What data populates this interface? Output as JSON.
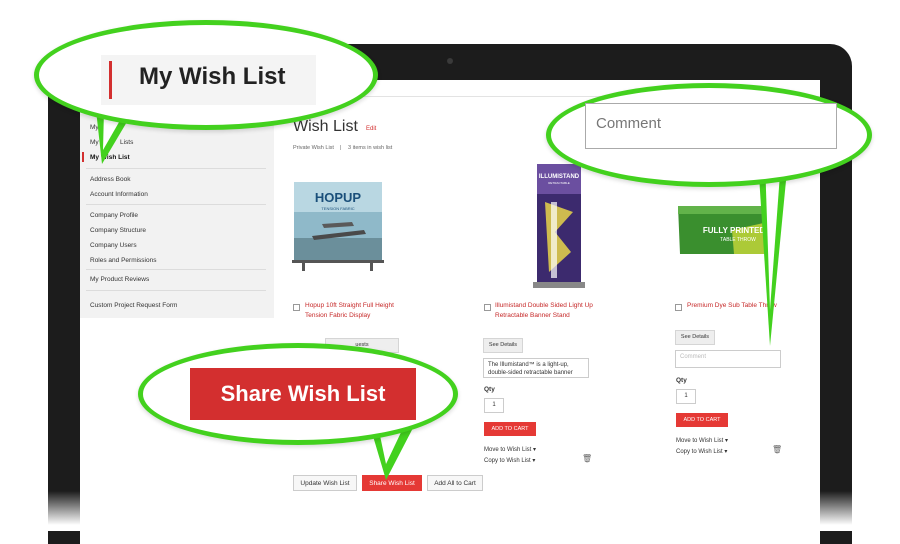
{
  "sidebar": {
    "items": [
      {
        "label": "My Sa"
      },
      {
        "label": "My Re"
      },
      {
        "label": "Lists"
      },
      {
        "label": "My Wish List"
      },
      {
        "label": "Address Book"
      },
      {
        "label": "Account Information"
      },
      {
        "label": "Company Profile"
      },
      {
        "label": "Company Structure"
      },
      {
        "label": "Company Users"
      },
      {
        "label": "Roles and Permissions"
      },
      {
        "label": "My Product Reviews"
      },
      {
        "label": "Custom Project Request Form"
      }
    ]
  },
  "header": {
    "tab_fragment": "st"
  },
  "wishlist": {
    "title": "Wish List",
    "edit_label": "Edit",
    "privacy": "Private Wish List",
    "count": "3 items in wish list",
    "products": [
      {
        "name": "Hopup 10ft Straight Full Height Tension Fabric Display",
        "image_text": "HOPUP",
        "image_subtext": "TENSION FABRIC"
      },
      {
        "name": "Illumistand Double Sided Light Up Retractable Banner Stand",
        "image_text": "ILLUMISTAND",
        "image_subtext": "RETRACTABLE",
        "details_label": "See Details",
        "comment_value": "The Illumistand™ is a light-up, double-sided retractable banner",
        "qty_label": "Qty",
        "qty_value": "1",
        "add_to_cart": "ADD TO CART",
        "move_label": "Move to Wish List",
        "copy_label": "Copy to Wish List"
      },
      {
        "name": "Premium Dye Sub Table Throw",
        "image_text": "FULLY PRINTED",
        "image_subtext": "TABLE THROW",
        "details_label": "See Details",
        "comment_placeholder": "Comment",
        "qty_label": "Qty",
        "qty_value": "1",
        "add_to_cart": "ADD TO CART",
        "move_label": "Move to Wish List",
        "copy_label": "Copy to Wish List"
      }
    ],
    "first_card_button_fragment": "uests"
  },
  "actions": {
    "update": "Update Wish List",
    "share": "Share Wish List",
    "add_all": "Add All to Cart"
  },
  "callouts": {
    "wishlist_label": "My Wish List",
    "comment_placeholder": "Comment",
    "share_button": "Share Wish List"
  },
  "colors": {
    "accent_red": "#d32f2f",
    "callout_green": "#43d11e"
  }
}
